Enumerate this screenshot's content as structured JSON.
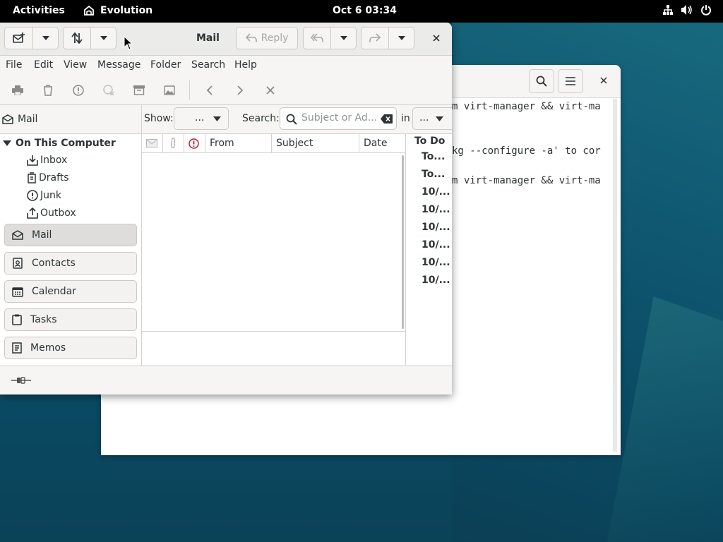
{
  "topbar": {
    "activities": "Activities",
    "app_name": "Evolution",
    "clock": "Oct 6  03:34"
  },
  "terminal": {
    "lines": [
      "m virt-manager && virt-ma",
      "kg --configure -a' to cor",
      "m virt-manager && virt-ma"
    ]
  },
  "window": {
    "title": "Mail",
    "reply_label": "Reply"
  },
  "menu": {
    "items": [
      "File",
      "Edit",
      "View",
      "Message",
      "Folder",
      "Search",
      "Help"
    ]
  },
  "sidebar": {
    "header": "Mail",
    "root": "On This Computer",
    "folders": [
      "Inbox",
      "Drafts",
      "Junk",
      "Outbox"
    ],
    "switcher": [
      "Mail",
      "Contacts",
      "Calendar",
      "Tasks",
      "Memos"
    ]
  },
  "filter": {
    "show_label": "Show:",
    "show_value": "...",
    "search_label": "Search:",
    "search_placeholder": "Subject or Ad...",
    "in_label": "in",
    "in_value": "..."
  },
  "columns": [
    "From",
    "Subject",
    "Date"
  ],
  "todo": {
    "header": "To Do",
    "items": [
      "To...",
      "To...",
      "10/...",
      "10/...",
      "10/...",
      "10/...",
      "10/...",
      "10/..."
    ]
  }
}
